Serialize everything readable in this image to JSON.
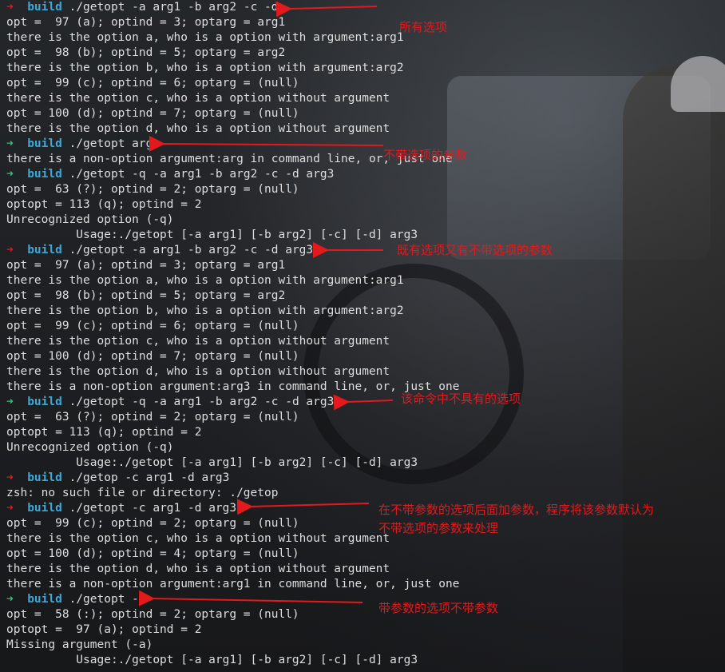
{
  "theme": {
    "ok_color": "#2ec27e",
    "err_color": "#e4191c",
    "dir_color": "#3fa7d6",
    "text_color": "#dedede",
    "annotation_color": "#e4191c"
  },
  "terminal": {
    "lines": [
      {
        "type": "prompt",
        "status": "err",
        "arrow": "➜",
        "dir": "build",
        "cmd": "./getopt -a arg1 -b arg2 -c -d"
      },
      {
        "type": "out",
        "text": "opt =  97 (a); optind = 3; optarg = arg1"
      },
      {
        "type": "out",
        "text": "there is the option a, who is a option with argument:arg1"
      },
      {
        "type": "out",
        "text": "opt =  98 (b); optind = 5; optarg = arg2"
      },
      {
        "type": "out",
        "text": "there is the option b, who is a option with argument:arg2"
      },
      {
        "type": "out",
        "text": "opt =  99 (c); optind = 6; optarg = (null)"
      },
      {
        "type": "out",
        "text": "there is the option c, who is a option without argument"
      },
      {
        "type": "out",
        "text": "opt = 100 (d); optind = 7; optarg = (null)"
      },
      {
        "type": "out",
        "text": "there is the option d, who is a option without argument"
      },
      {
        "type": "prompt",
        "status": "ok",
        "arrow": "➜",
        "dir": "build",
        "cmd": "./getopt arg"
      },
      {
        "type": "out",
        "text": "there is a non-option argument:arg in command line, or, just one"
      },
      {
        "type": "prompt",
        "status": "ok",
        "arrow": "➜",
        "dir": "build",
        "cmd": "./getopt -q -a arg1 -b arg2 -c -d arg3"
      },
      {
        "type": "out",
        "text": "opt =  63 (?); optind = 2; optarg = (null)"
      },
      {
        "type": "out",
        "text": "optopt = 113 (q); optind = 2"
      },
      {
        "type": "out",
        "text": "Unrecognized option (-q)"
      },
      {
        "type": "out",
        "text": "          Usage:./getopt [-a arg1] [-b arg2] [-c] [-d] arg3"
      },
      {
        "type": "prompt",
        "status": "err",
        "arrow": "➜",
        "dir": "build",
        "cmd": "./getopt -a arg1 -b arg2 -c -d arg3"
      },
      {
        "type": "out",
        "text": "opt =  97 (a); optind = 3; optarg = arg1"
      },
      {
        "type": "out",
        "text": "there is the option a, who is a option with argument:arg1"
      },
      {
        "type": "out",
        "text": "opt =  98 (b); optind = 5; optarg = arg2"
      },
      {
        "type": "out",
        "text": "there is the option b, who is a option with argument:arg2"
      },
      {
        "type": "out",
        "text": "opt =  99 (c); optind = 6; optarg = (null)"
      },
      {
        "type": "out",
        "text": "there is the option c, who is a option without argument"
      },
      {
        "type": "out",
        "text": "opt = 100 (d); optind = 7; optarg = (null)"
      },
      {
        "type": "out",
        "text": "there is the option d, who is a option without argument"
      },
      {
        "type": "out",
        "text": "there is a non-option argument:arg3 in command line, or, just one"
      },
      {
        "type": "prompt",
        "status": "ok",
        "arrow": "➜",
        "dir": "build",
        "cmd": "./getopt -q -a arg1 -b arg2 -c -d arg3"
      },
      {
        "type": "out",
        "text": "opt =  63 (?); optind = 2; optarg = (null)"
      },
      {
        "type": "out",
        "text": "optopt = 113 (q); optind = 2"
      },
      {
        "type": "out",
        "text": "Unrecognized option (-q)"
      },
      {
        "type": "out",
        "text": "          Usage:./getopt [-a arg1] [-b arg2] [-c] [-d] arg3"
      },
      {
        "type": "prompt",
        "status": "err",
        "arrow": "➜",
        "dir": "build",
        "cmd": "./getop -c arg1 -d arg3"
      },
      {
        "type": "out",
        "text": "zsh: no such file or directory: ./getop"
      },
      {
        "type": "prompt",
        "status": "err",
        "arrow": "➜",
        "dir": "build",
        "cmd": "./getopt -c arg1 -d arg3"
      },
      {
        "type": "out",
        "text": "opt =  99 (c); optind = 2; optarg = (null)"
      },
      {
        "type": "out",
        "text": "there is the option c, who is a option without argument"
      },
      {
        "type": "out",
        "text": "opt = 100 (d); optind = 4; optarg = (null)"
      },
      {
        "type": "out",
        "text": "there is the option d, who is a option without argument"
      },
      {
        "type": "out",
        "text": "there is a non-option argument:arg1 in command line, or, just one"
      },
      {
        "type": "prompt",
        "status": "ok",
        "arrow": "➜",
        "dir": "build",
        "cmd": "./getopt -a"
      },
      {
        "type": "out",
        "text": "opt =  58 (:); optind = 2; optarg = (null)"
      },
      {
        "type": "out",
        "text": "optopt =  97 (a); optind = 2"
      },
      {
        "type": "out",
        "text": "Missing argument (-a)"
      },
      {
        "type": "out",
        "text": "          Usage:./getopt [-a arg1] [-b arg2] [-c] [-d] arg3"
      }
    ]
  },
  "annotations": [
    {
      "id": "all-options",
      "text": "所有选项"
    },
    {
      "id": "no-option-arg",
      "text": "不带选项的参数"
    },
    {
      "id": "both",
      "text": "既有选项又有不带选项的参数"
    },
    {
      "id": "unknown-option",
      "text": "该命令中不具有的选项"
    },
    {
      "id": "extra-arg-line1",
      "text": "在不带参数的选项后面加参数，程序将该参数默认为"
    },
    {
      "id": "extra-arg-line2",
      "text": "不带选项的参数来处理"
    },
    {
      "id": "missing-arg",
      "text": "带参数的选项不带参数"
    }
  ]
}
